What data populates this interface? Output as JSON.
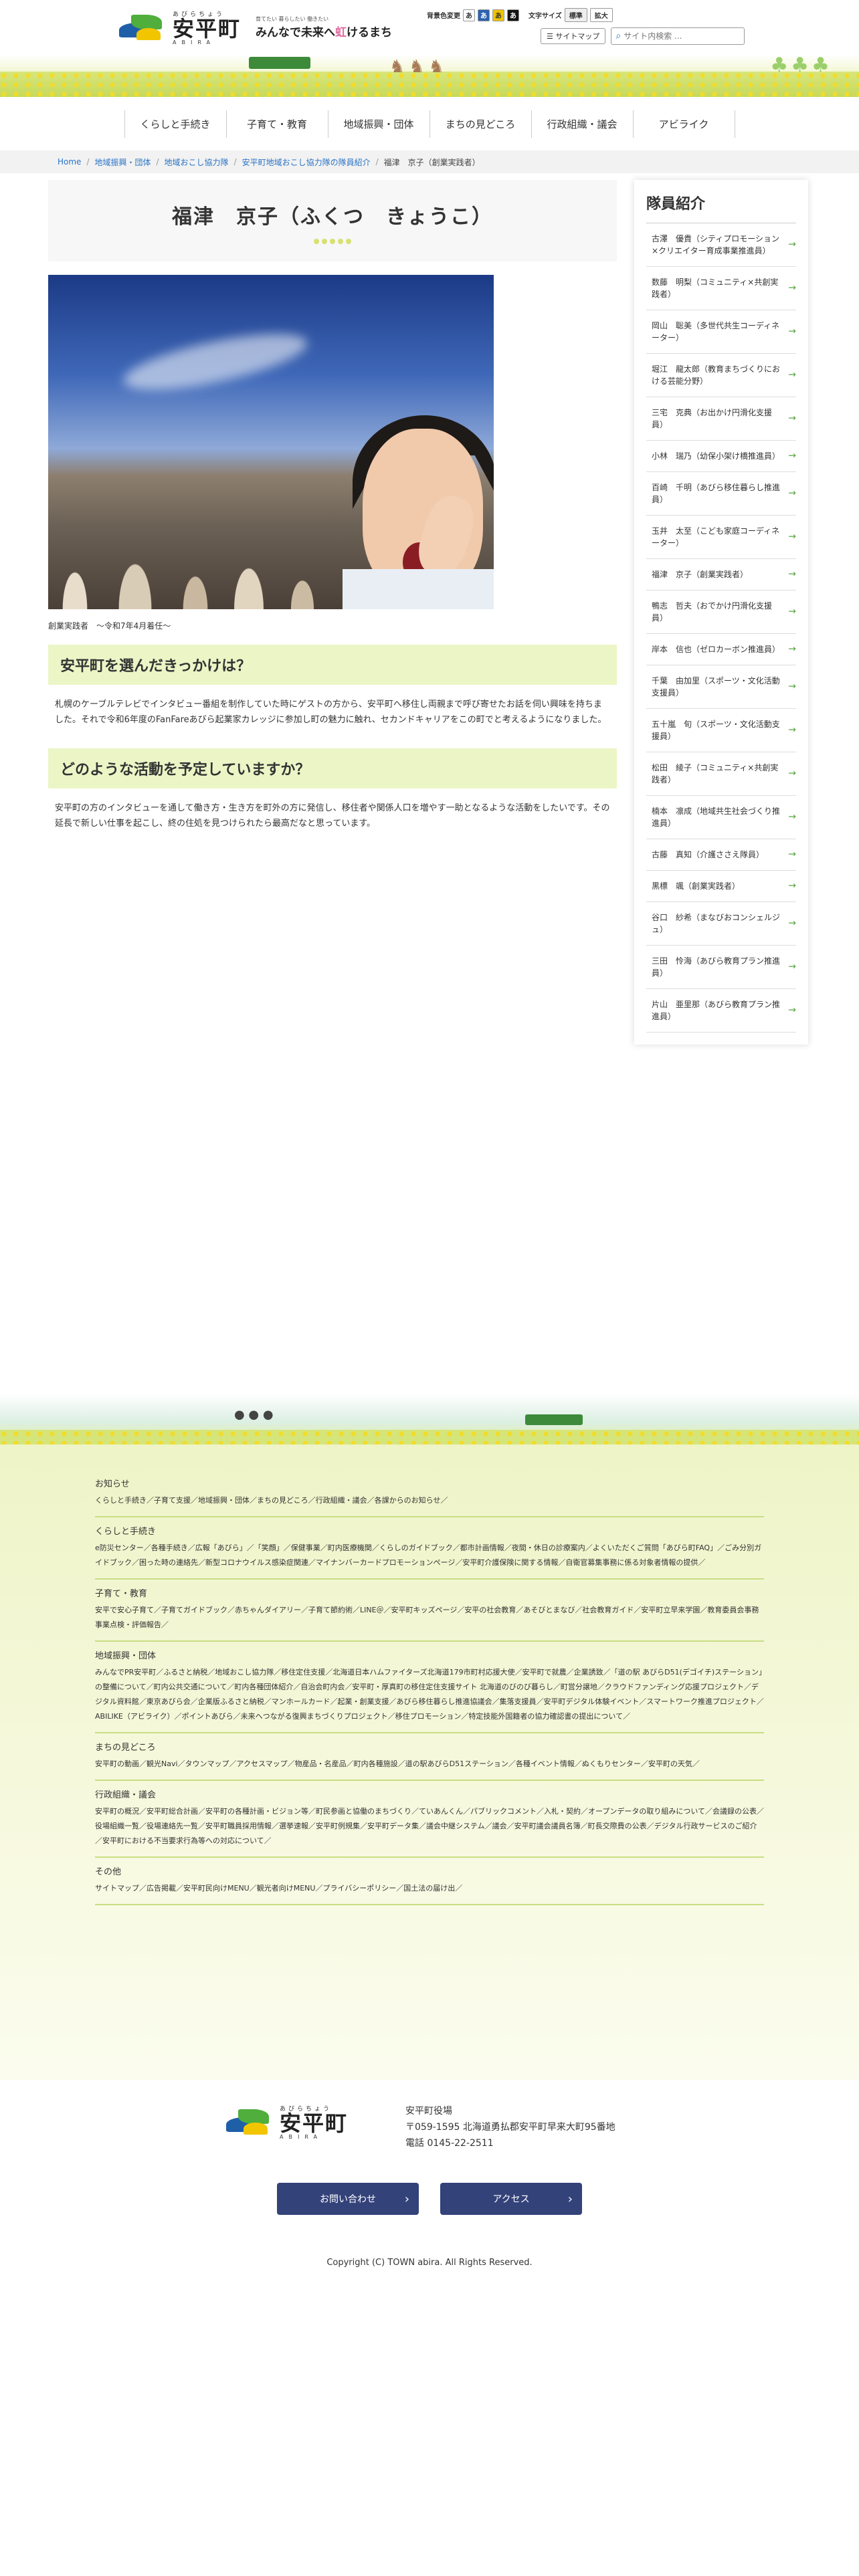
{
  "header": {
    "logo_ruby": "あびらちょう",
    "logo_name": "安平町",
    "logo_en": "ABIRA",
    "tagline_small": "育てたい 暮らしたい 働きたい",
    "tagline_main_before": "みんなで未来へ",
    "tagline_main_hl": "虹",
    "tagline_main_after": "けるまち",
    "bg_color_label": "背景色変更",
    "color_buttons": [
      "あ",
      "あ",
      "あ",
      "あ"
    ],
    "text_size_label": "文字サイズ",
    "text_size_buttons": [
      "標準",
      "拡大"
    ],
    "sitemap_label": "サイトマップ",
    "search_placeholder": "サイト内検索 ..."
  },
  "gnav": [
    "くらしと手続き",
    "子育て・教育",
    "地域振興・団体",
    "まちの見どころ",
    "行政組織・議会",
    "アビライク"
  ],
  "breadcrumb": [
    "Home",
    "地域振興・団体",
    "地域おこし協力隊",
    "安平町地域おこし協力隊の隊員紹介",
    "福津　京子（創業実践者）"
  ],
  "page": {
    "title": "福津　京子（ふくつ　きょうこ）",
    "caption": "創業実践者　～令和7年4月着任～",
    "sections": [
      {
        "heading": "安平町を選んだきっかけは？",
        "body": "札幌のケーブルテレビでインタビュー番組を制作していた時にゲストの方から、安平町へ移住し両親まで呼び寄せたお話を伺い興味を持ちました。それで令和6年度のFanFareあびら起業家カレッジに参加し町の魅力に触れ、セカンドキャリアをこの町でと考えるようになりました。"
      },
      {
        "heading": "どのような活動を予定していますか？",
        "body": "安平町の方のインタビューを通して働き方・生き方を町外の方に発信し、移住者や関係人口を増やす一助となるような活動をしたいです。その延長で新しい仕事を起こし、終の住処を見つけられたら最高だなと思っています。"
      }
    ]
  },
  "sidebar": {
    "title": "隊員紹介",
    "members": [
      "古澤　優貴（シティプロモーション×クリエイター育成事業推進員）",
      "数藤　明梨（コミュニティ×共創実践者）",
      "岡山　聡美（多世代共生コーディネーター）",
      "堀江　龍太郎（教育まちづくりにおける芸能分野）",
      "三宅　克典（お出かけ円滑化支援員）",
      "小林　瑞乃（幼保小架け橋推進員）",
      "百崎　千明（あびら移住暮らし推進員）",
      "玉井　太至（こども家庭コーディネーター）",
      "福津　京子（創業実践者）",
      "鴨志　哲夫（おでかけ円滑化支援員）",
      "岸本　信也（ゼロカーボン推進員）",
      "千葉　由加里（スポーツ・文化活動支援員）",
      "五十嵐　旬（スポーツ・文化活動支援員）",
      "松田　綾子（コミュニティ×共創実践者）",
      "楠本　凛成（地域共生社会づくり推進員）",
      "古藤　真知（介護ささえ隊員）",
      "黒標　颯（創業実践者）",
      "谷口　紗希（まなびおコンシェルジュ）",
      "三田　怜海（あびら教育プラン推進員）",
      "片山　亜里那（あびら教育プラン推進員）"
    ]
  },
  "footer": {
    "groups": [
      {
        "title": "お知らせ",
        "text": "くらしと手続き／子育て支援／地域振興・団体／まちの見どころ／行政組織・議会／各課からのお知らせ／"
      },
      {
        "title": "くらしと手続き",
        "text": "e防災センター／各種手続き／広報「あびら」／「笑顔」／保健事業／町内医療機関／くらしのガイドブック／都市計画情報／夜間・休日の診療案内／よくいただくご質問「あびら町FAQ」／ごみ分別ガイドブック／困った時の連絡先／新型コロナウイルス感染症関連／マイナンバーカードプロモーションページ／安平町介護保険に関する情報／自衛官募集事務に係る対象者情報の提供／"
      },
      {
        "title": "子育て・教育",
        "text": "安平で安心子育て／子育てガイドブック／赤ちゃんダイアリー／子育て節約術／LINE＠／安平町キッズページ／安平の社会教育／あそびとまなび／社会教育ガイド／安平町立早来学園／教育委員会事務事業点検・評価報告／"
      },
      {
        "title": "地域振興・団体",
        "text": "みんなでPR安平町／ふるさと納税／地域おこし協力隊／移住定住支援／北海道日本ハムファイターズ北海道179市町村応援大使／安平町で就農／企業誘致／「道の駅 あびらD51(デゴイチ)ステーション」の整備について／町内公共交通について／町内各種団体紹介／自治会町内会／安平町・厚真町の移住定住支援サイト 北海道のびのび暮らし／町営分譲地／クラウドファンディング応援プロジェクト／デジタル資料館／東京あびら会／企業版ふるさと納税／マンホールカード／起業・創業支援／あびら移住暮らし推進協議会／集落支援員／安平町デジタル体験イベント／スマートワーク推進プロジェクト／ABILIKE（アビライク）／ポイントあびら／未来へつながる復興まちづくりプロジェクト／移住プロモーション／特定技能外国籍者の協力確認書の提出について／"
      },
      {
        "title": "まちの見どころ",
        "text": "安平町の動画／観光Navi／タウンマップ／アクセスマップ／物産品・名産品／町内各種施設／道の駅あびらD51ステーション／各種イベント情報／ぬくもりセンター／安平町の天気／"
      },
      {
        "title": "行政組織・議会",
        "text": "安平町の概況／安平町総合計画／安平町の各種計画・ビジョン等／町民参画と協働のまちづくり／ていあんくん／パブリックコメント／入札・契約／オープンデータの取り組みについて／会議録の公表／役場組織一覧／役場連絡先一覧／安平町職員採用情報／選挙速報／安平町例規集／安平町データ集／議会中継システム／議会／安平町議会議員名簿／町長交際費の公表／デジタル行政サービスのご紹介／安平町における不当要求行為等への対応について／"
      },
      {
        "title": "その他",
        "text": "サイトマップ／広告掲載／安平町民向けMENU／観光者向けMENU／プライバシーポリシー／国土法の届け出／"
      }
    ],
    "office_name": "安平町役場",
    "address": "〒059-1595 北海道勇払郡安平町早来大町95番地",
    "tel": "電話 0145-22-2511",
    "contact_button": "お問い合わせ",
    "access_button": "アクセス",
    "copyright": "Copyright (C) TOWN abira. All Rights Reserved."
  },
  "colors": {
    "nav_button": "#34427a",
    "section_head": "#ebf5c6",
    "link": "#2a73c5",
    "arrow": "#5aa540"
  }
}
